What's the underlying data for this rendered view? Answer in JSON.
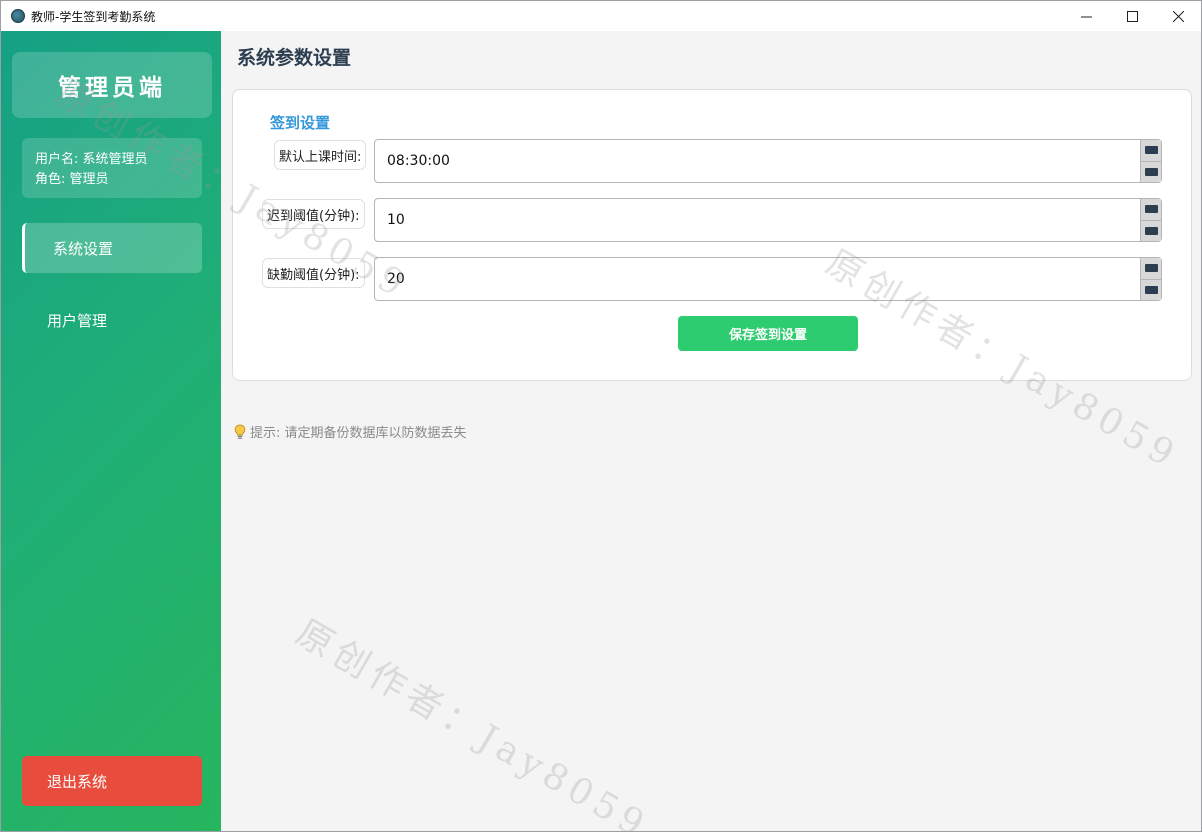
{
  "window": {
    "title": "教师-学生签到考勤系统",
    "controls": {
      "minimize": "minimize-icon",
      "maximize": "maximize-icon",
      "close": "close-icon"
    }
  },
  "sidebar": {
    "role_title": "管理员端",
    "user": {
      "name_line": "用户名: 系统管理员",
      "role_line": "角色: 管理员"
    },
    "nav": [
      {
        "label": "系统设置",
        "active": true
      },
      {
        "label": "用户管理",
        "active": false
      }
    ],
    "logout_label": "退出系统",
    "gradient": [
      "#16a085",
      "#27b55f"
    ]
  },
  "main": {
    "page_title": "系统参数设置",
    "section_title": "签到设置",
    "fields": [
      {
        "label": "默认上课时间:",
        "value": "08:30:00"
      },
      {
        "label": "迟到阈值(分钟):",
        "value": "10"
      },
      {
        "label": "缺勤阈值(分钟):",
        "value": "20"
      }
    ],
    "save_label": "保存签到设置",
    "tip": "提示: 请定期备份数据库以防数据丢失",
    "tip_icon": "lightbulb-icon"
  },
  "watermark": "原创作者：Jay8059",
  "colors": {
    "accent_blue": "#3498db",
    "save_green": "#2ecc71",
    "logout_red": "#e74c3c",
    "title_dark": "#2c3e50"
  }
}
